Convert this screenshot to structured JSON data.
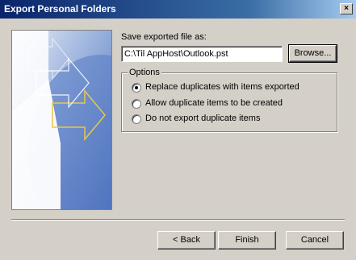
{
  "window": {
    "title": "Export Personal Folders",
    "close_glyph": "×"
  },
  "save_label": "Save exported file as:",
  "file_path": "C:\\Til AppHost\\Outlook.pst",
  "browse_label": "Browse...",
  "options": {
    "legend": "Options",
    "items": [
      {
        "label": "Replace duplicates with items exported",
        "selected": true
      },
      {
        "label": "Allow duplicate items to be created",
        "selected": false
      },
      {
        "label": "Do not export duplicate items",
        "selected": false
      }
    ]
  },
  "footer": {
    "back_label": "< Back",
    "finish_label": "Finish",
    "cancel_label": "Cancel"
  }
}
